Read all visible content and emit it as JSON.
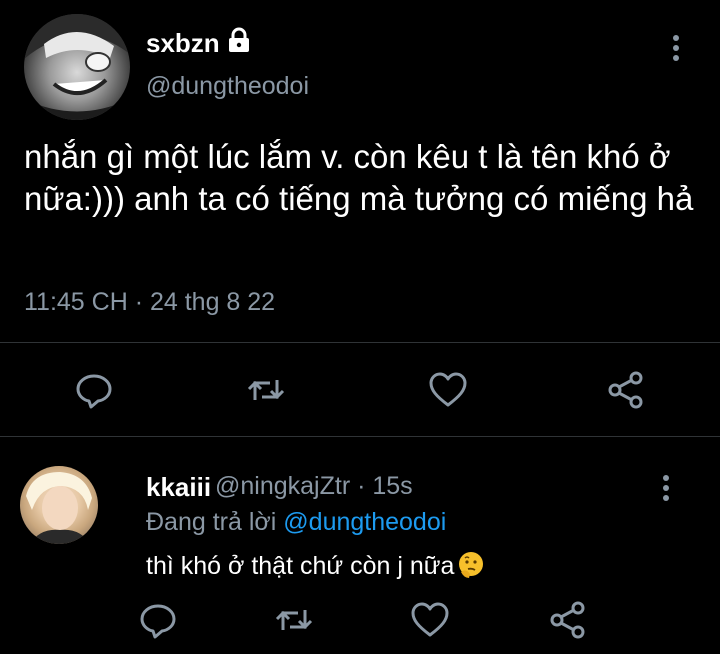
{
  "tweet": {
    "display_name": "sxbzn",
    "handle": "@dungtheodoi",
    "text": "nhắn gì một lúc lắm v. còn kêu t là tên khó ở nữa:))) anh ta có tiếng mà tưởng có miếng hả",
    "timestamp": "11:45 CH · 24 thg 8 22",
    "icons": [
      "lock-icon",
      "more-options-icon",
      "reply-icon",
      "retweet-icon",
      "like-icon",
      "share-icon"
    ]
  },
  "reply": {
    "display_name": "kkaiii",
    "handle_time": "@ningkajZtr · 15s",
    "replying_to_prefix": "Đang trả lời ",
    "replying_to_mention": "@dungtheodoi",
    "text": "thì khó ở thật chứ còn j nữa",
    "emoji": "thinking-face-emoji"
  },
  "colors": {
    "background": "#000000",
    "text": "#ffffff",
    "secondary_text": "#8b98a5",
    "link": "#1d9bf0",
    "icon": "#8b98a5",
    "divider": "#2f3336"
  }
}
